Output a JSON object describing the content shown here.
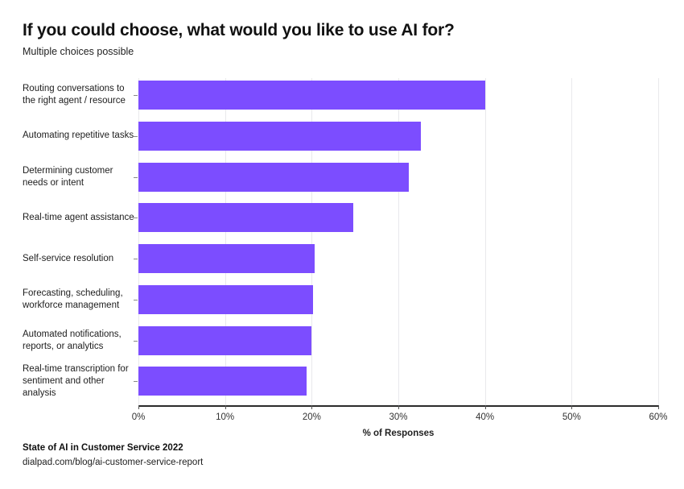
{
  "header": {
    "title": "If you could choose, what would you like to use AI for?",
    "subtitle": "Multiple choices possible"
  },
  "footer": {
    "source_title": "State of AI in Customer Service 2022",
    "source_url": "dialpad.com/blog/ai-customer-service-report"
  },
  "colors": {
    "bar": "#7c4dff",
    "gridline": "#e9e9ec",
    "axis": "#2b2b2b",
    "background": "#ffffff",
    "text": "#1a1a1a"
  },
  "chart_data": {
    "type": "bar",
    "orientation": "horizontal",
    "title": "If you could choose, what would you like to use AI for?",
    "subtitle": "Multiple choices possible",
    "xlabel": "% of Responses",
    "ylabel": "",
    "xlim": [
      0,
      60
    ],
    "xticks": [
      0,
      10,
      20,
      30,
      40,
      50,
      60
    ],
    "xtick_labels": [
      "0%",
      "10%",
      "20%",
      "30%",
      "40%",
      "50%",
      "60%"
    ],
    "grid": true,
    "grid_axis": "x",
    "legend": false,
    "series_color": "#7c4dff",
    "categories": [
      "Routing conversations to the right agent / resource",
      "Automating repetitive tasks",
      "Determining customer needs or intent",
      "Real-time agent assistance",
      "Self-service resolution",
      "Forecasting, scheduling, workforce management",
      "Automated notifications, reports, or analytics",
      "Real-time transcription for sentiment and other analysis"
    ],
    "values": [
      40.0,
      32.6,
      31.2,
      24.8,
      20.3,
      20.2,
      20.0,
      19.4
    ]
  }
}
